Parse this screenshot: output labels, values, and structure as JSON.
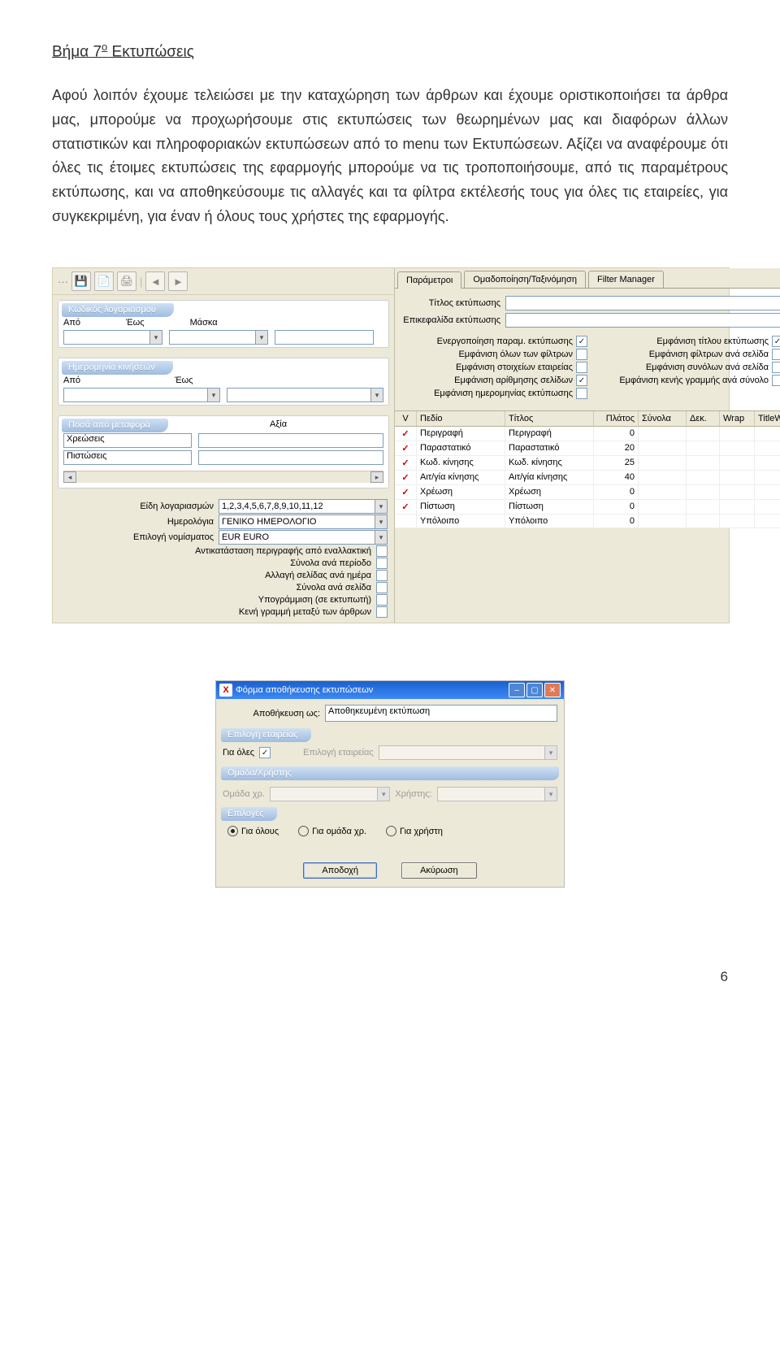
{
  "doc": {
    "heading": "Βήμα 7",
    "heading_suffix": " Εκτυπώσεις",
    "paragraph": "Αφού λοιπόν έχουμε τελειώσει με την καταχώρηση των άρθρων και έχουμε οριστικοποιήσει τα άρθρα μας, μπορούμε να προχωρήσουμε στις εκτυπώσεις των θεωρημένων μας και διαφόρων άλλων στατιστικών και πληροφοριακών εκτυπώσεων από το menu των Εκτυπώσεων. Αξίζει να αναφέρουμε ότι όλες τις έτοιμες εκτυπώσεις της εφαρμογής μπορούμε να τις τροποποιήσουμε, από τις παραμέτρους εκτύπωσης, και να αποθηκεύσουμε τις αλλαγές και τα φίλτρα εκτέλεσής τους για όλες τις εταιρείες, για συγκεκριμένη, για έναν ή όλους τους χρήστες της εφαρμογής.",
    "pagenum": "6"
  },
  "shot1": {
    "left": {
      "group1": {
        "caption": "Κωδικός λογαριασμού",
        "apo": "Από",
        "eos": "Έως",
        "maska": "Μάσκα"
      },
      "group2": {
        "caption": "Ημερομηνία κινήσεων",
        "apo": "Από",
        "eos": "Έως"
      },
      "group3": {
        "caption": "Ποσά από μεταφορά",
        "col2": "Αξία",
        "row1": "Χρεώσεις",
        "row2": "Πιστώσεις"
      },
      "opts": {
        "eidi_label": "Είδη λογαριασμών",
        "eidi_value": "1,2,3,4,5,6,7,8,9,10,11,12",
        "imerol_label": "Ημερολόγια",
        "imerol_value": "ΓΕΝΙΚΟ ΗΜΕΡΟΛΟΓΙΟ",
        "nom_label": "Επιλογή νομίσματος",
        "nom_value": "EUR EURO",
        "cb1": "Αντικατάσταση περιγραφής από εναλλακτική",
        "cb2": "Σύνολα ανά περίοδο",
        "cb3": "Αλλαγή σελίδας ανά ημέρα",
        "cb4": "Σύνολα ανά σελίδα",
        "cb5": "Υπογράμμιση (σε εκτυπωτή)",
        "cb6": "Κενή γραμμή μεταξύ των άρθρων"
      }
    },
    "right": {
      "tabs": [
        "Παράμετροι",
        "Ομαδοποίηση/Ταξινόμηση",
        "Filter Manager"
      ],
      "title_label": "Τίτλος εκτύπωσης",
      "header_label": "Επικεφαλίδα εκτύπωσης",
      "checks_left": [
        {
          "lbl": "Ενεργοποίηση παραμ. εκτύπωσης",
          "on": true
        },
        {
          "lbl": "Εμφάνιση όλων των φίλτρων",
          "on": false
        },
        {
          "lbl": "Εμφάνιση στοιχείων εταιρείας",
          "on": false
        },
        {
          "lbl": "Εμφάνιση αρίθμησης σελίδων",
          "on": true
        },
        {
          "lbl": "Εμφάνιση ημερομηνίας εκτύπωσης",
          "on": false
        }
      ],
      "checks_right": [
        {
          "lbl": "Εμφάνιση τίτλου εκτύπωσης",
          "on": true
        },
        {
          "lbl": "Εμφάνιση φίλτρων ανά σελίδα",
          "on": false
        },
        {
          "lbl": "Εμφάνιση συνόλων ανά σελίδα",
          "on": false
        },
        {
          "lbl": "Εμφάνιση κενής γραμμής ανά σύνολο",
          "on": false
        }
      ],
      "table": {
        "header": [
          "V",
          "Πεδίο",
          "Τίτλος",
          "Πλάτος",
          "Σύνολα",
          "Δεκ.",
          "Wrap",
          "TitleW"
        ],
        "rows": [
          {
            "v": "✓",
            "field": "Περιγραφή",
            "title": "Περιγραφή",
            "w": "0"
          },
          {
            "v": "✓",
            "field": "Παραστατικό",
            "title": "Παραστατικό",
            "w": "20"
          },
          {
            "v": "✓",
            "field": "Κωδ. κίνησης",
            "title": "Κωδ. κίνησης",
            "w": "25"
          },
          {
            "v": "✓",
            "field": "Αιτ/γία κίνησης",
            "title": "Αιτ/γία κίνησης",
            "w": "40"
          },
          {
            "v": "✓",
            "field": "Χρέωση",
            "title": "Χρέωση",
            "w": "0"
          },
          {
            "v": "✓",
            "field": "Πίστωση",
            "title": "Πίστωση",
            "w": "0"
          },
          {
            "v": "",
            "field": "Υπόλοιπο",
            "title": "Υπόλοιπο",
            "w": "0"
          }
        ]
      }
    }
  },
  "shot2": {
    "title": "Φόρμα αποθήκευσης εκτυπώσεων",
    "save_as_label": "Αποθήκευση ως:",
    "save_as_value": "Αποθηκευμένη εκτύπωση",
    "sec_company": "Επιλογή εταιρείας",
    "for_all": "Για όλες",
    "company_sel": "Επιλογή εταιρείας",
    "sec_group": "Ομάδα/Χρήστης",
    "group_label": "Ομάδα χρ.",
    "user_label": "Χρήστης:",
    "sec_options": "Επιλογές",
    "r1": "Για όλους",
    "r2": "Για ομάδα χρ.",
    "r3": "Για χρήστη",
    "btn_ok": "Αποδοχή",
    "btn_cancel": "Ακύρωση"
  }
}
